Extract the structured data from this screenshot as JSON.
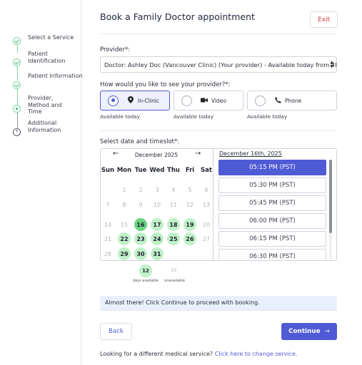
{
  "header": {
    "title": "Book a Family Doctor appointment",
    "exit_label": "Exit"
  },
  "stepper": [
    {
      "label": "Select a Service",
      "status": "done"
    },
    {
      "label": "Patient Identification",
      "status": "done"
    },
    {
      "label": "Patient Information",
      "status": "done"
    },
    {
      "label": "Provider, Method and Time",
      "status": "current"
    },
    {
      "label": "Additional Information",
      "status": "todo"
    }
  ],
  "provider": {
    "label": "Provider*:",
    "value": "Doctor: Ashley Doc (Vancouver Clinic) (Your provider) - Available today from 4PM"
  },
  "visit_type": {
    "label": "How would you like to see your provider?*:",
    "options": [
      {
        "label": "In-Clinic",
        "icon": "location-pin-icon",
        "availability": "Available today",
        "selected": true
      },
      {
        "label": "Video",
        "icon": "video-camera-icon",
        "availability": "Available today",
        "selected": false
      },
      {
        "label": "Phone",
        "icon": "phone-icon",
        "availability": "Available today",
        "selected": false
      }
    ]
  },
  "calendar": {
    "label": "Select date and timeslot*:",
    "month": "December 2025",
    "prev_icon": "←",
    "next_icon": "→",
    "weekdays": [
      "Sun",
      "Mon",
      "Tue",
      "Wed",
      "Thu",
      "Fri",
      "Sat"
    ],
    "weeks": [
      [
        "",
        1,
        2,
        3,
        4,
        5,
        6
      ],
      [
        7,
        8,
        9,
        10,
        11,
        12,
        13
      ],
      [
        14,
        15,
        16,
        17,
        18,
        19,
        20
      ],
      [
        21,
        22,
        23,
        24,
        25,
        26,
        27
      ],
      [
        28,
        29,
        30,
        31,
        "",
        "",
        ""
      ]
    ],
    "available_days": [
      16,
      17,
      18,
      19,
      22,
      23,
      24,
      25,
      26,
      29,
      30,
      31
    ],
    "selected_day": 16,
    "legend": {
      "available_count": "12",
      "available_label": "days available",
      "unavailable_count": "19",
      "unavailable_label": "unavailable"
    }
  },
  "timeslots": {
    "date_label": "December 16th, 2025",
    "slots": [
      "05:15 PM (PST)",
      "05:30 PM (PST)",
      "05:45 PM (PST)",
      "06:00 PM (PST)",
      "06:15 PM (PST)",
      "06:30 PM (PST)"
    ],
    "selected_index": 0
  },
  "notice": "Almost there! Click Continue to proceed with booking.",
  "actions": {
    "back_label": "Back",
    "continue_label": "Continue",
    "continue_icon": "→"
  },
  "footer": {
    "text": "Looking for a different medical service?",
    "link": "Click here to change service."
  },
  "colors": {
    "accent": "#4f5bd5",
    "available": "#bff0c7",
    "selected_day": "#6ad47f",
    "exit": "#d33a3a"
  }
}
